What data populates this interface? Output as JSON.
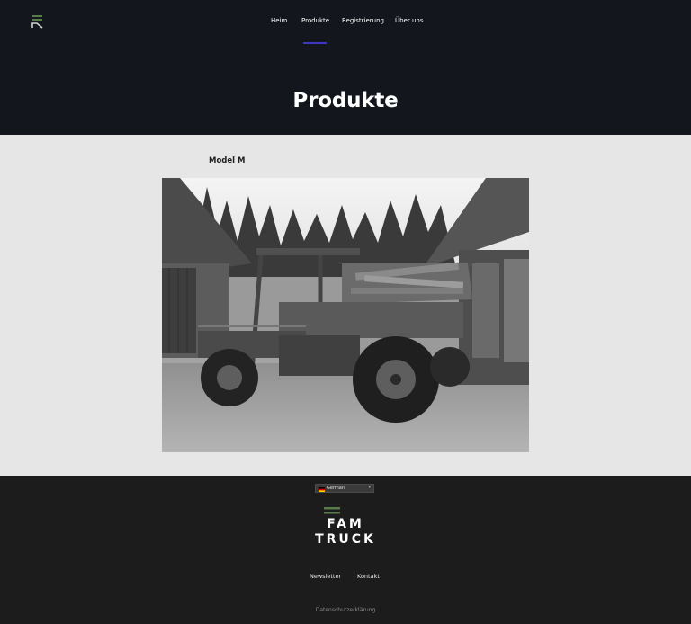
{
  "header": {
    "logo_icon": "stacked-bars-logo",
    "nav": [
      {
        "label": "Heim"
      },
      {
        "label": "Produkte",
        "active": true
      },
      {
        "label": "Registrierung"
      },
      {
        "label": "Über uns"
      }
    ],
    "active_color": "#3f35c6"
  },
  "page_title": "Produkte",
  "product": {
    "name": "Model M",
    "image": "grayscale photo of an open-cab off-road utility truck loaded with firewood"
  },
  "footer": {
    "language": {
      "label": "German",
      "icon": "germany-flag-icon"
    },
    "brand_line1": "FAM",
    "brand_line2": "TRUCK",
    "brand_accent": "#5a7a4a",
    "links": [
      {
        "label": "Newsletter"
      },
      {
        "label": "Kontakt"
      }
    ],
    "privacy": "Datenschutzerklärung"
  }
}
